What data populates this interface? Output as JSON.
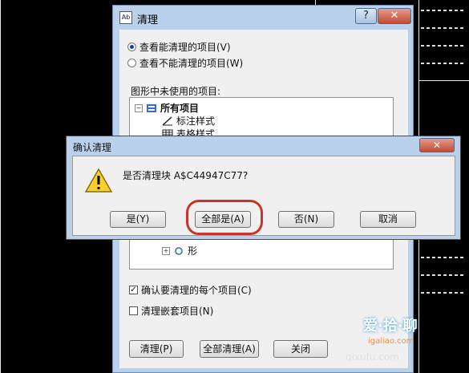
{
  "purge_dialog": {
    "title": "清理",
    "app_icon_text": "Ab",
    "help_button": "?",
    "close_button": "✕",
    "radio_purgeable": "查看能清理的项目(V)",
    "radio_nonpurgeable": "查看不能清理的项目(W)",
    "group_label": "图形中未使用的项目:",
    "tree": {
      "root": "所有项目",
      "items": [
        "标注样式",
        "表格样式"
      ],
      "partial_item": "形"
    },
    "check_confirm": "确认要清理的每个项目(C)",
    "check_nested": "清理嵌套项目(N)",
    "buttons": {
      "purge": "清理(P)",
      "purge_all": "全部清理(A)",
      "close": "关闭"
    }
  },
  "confirm_dialog": {
    "title": "确认清理",
    "close_button": "✕",
    "message": "是否清理块 A$C44947C77?",
    "buttons": {
      "yes": "是(Y)",
      "yes_all": "全部是(A)",
      "no": "否(N)",
      "cancel": "取消"
    }
  },
  "watermark": {
    "line1": "爱·拾·聊",
    "line2": "igaliao.com",
    "line3": "qixufu.com"
  },
  "colors": {
    "highlight_oval": "#c8332b",
    "dialog_frame": "#b9d1ea"
  }
}
